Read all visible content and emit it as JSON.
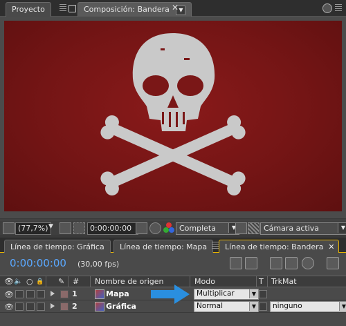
{
  "top_tabs": {
    "project": "Proyecto",
    "composition": "Composición: Bandera"
  },
  "viewer_toolbar": {
    "zoom": "(77,7%)",
    "timecode": "0:00:00:00",
    "resolution": "Completa",
    "camera": "Cámara activa"
  },
  "timeline_tabs": [
    "Línea de tiempo: Gráfica",
    "Línea de tiempo: Mapa",
    "Línea de tiempo: Bandera"
  ],
  "timeline": {
    "timecode": "0:00:00:00",
    "fps": "(30,00 fps)",
    "headers": {
      "hash": "#",
      "source_name": "Nombre de origen",
      "mode": "Modo",
      "t": "T",
      "trkmat": "TrkMat"
    },
    "layers": [
      {
        "num": "1",
        "name": "Mapa",
        "mode": "Multiplicar",
        "trkmat": ""
      },
      {
        "num": "2",
        "name": "Gráfica",
        "mode": "Normal",
        "trkmat": "ninguno"
      }
    ]
  },
  "colors": {
    "flag_red": "#7a1717",
    "timecode_blue": "#5aa8ff",
    "highlight_arrow": "#2a8fe0",
    "active_tab_border": "#e8b400"
  }
}
